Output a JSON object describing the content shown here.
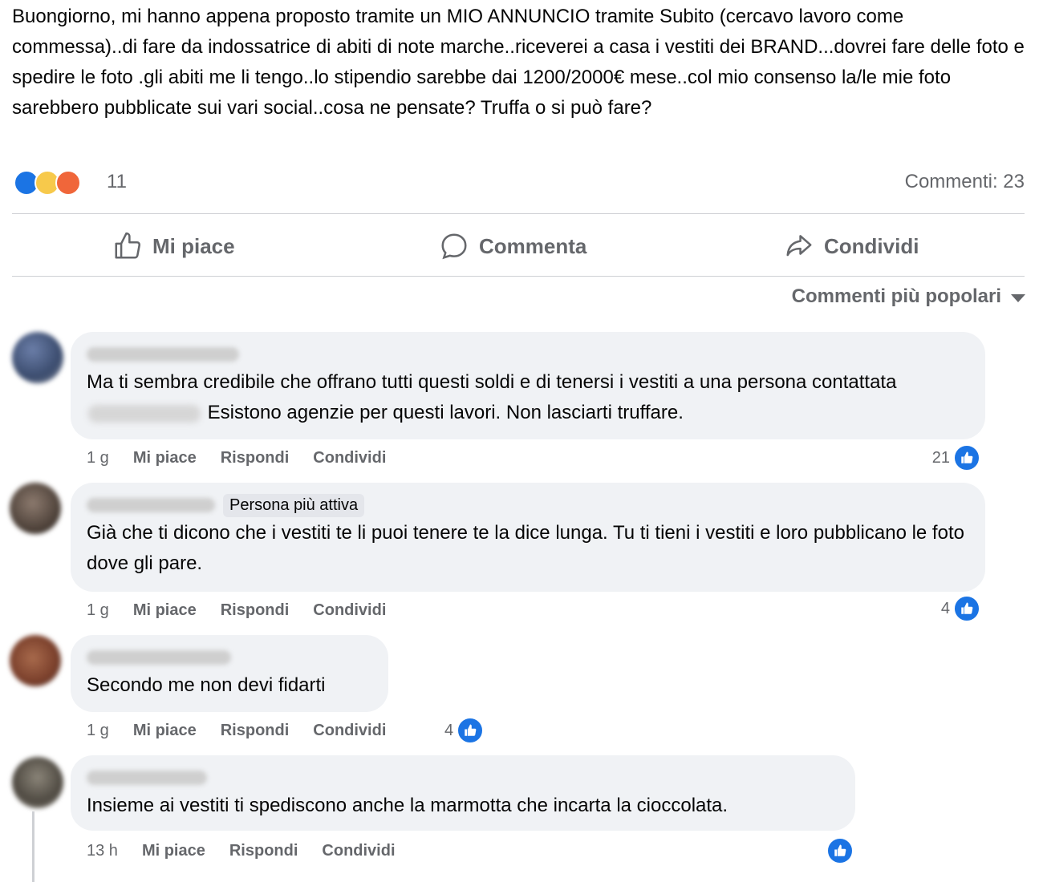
{
  "post": {
    "text": "Buongiorno, mi hanno appena proposto tramite un MIO ANNUNCIO tramite Subito (cercavo lavoro come commessa)..di fare da indossatrice di abiti di note marche..riceverei a casa i vestiti dei BRAND...dovrei fare delle foto e spedire le foto .gli abiti me li tengo..lo stipendio sarebbe dai 1200/2000€ mese..col mio consenso la/le mie foto sarebbero pubblicate sui vari social..cosa ne pensate? Truffa o si può fare?",
    "reaction_icons": [
      "like-icon",
      "haha-icon",
      "angry-icon"
    ],
    "reaction_count": "11",
    "comments_count": "Commenti: 23"
  },
  "actions": {
    "like": "Mi piace",
    "comment": "Commenta",
    "share": "Condividi"
  },
  "sort_label": "Commenti più popolari",
  "colors": {
    "accent": "#1b74e4",
    "secondary_text": "#65676b",
    "bubble_bg": "#f0f2f5"
  },
  "comments": [
    {
      "text_before": "Ma ti sembra credibile che offrano tutti questi soldi e di tenersi i vestiti a una persona contattata",
      "text_after": "Esistono agenzie per questi lavori. Non lasciarti truffare.",
      "time": "1 g",
      "like": "Mi piace",
      "reply": "Rispondi",
      "share": "Condividi",
      "likes": "21"
    },
    {
      "badge": "Persona più attiva",
      "text": "Già che ti dicono che i vestiti te li puoi tenere te la dice lunga. Tu ti tieni i vestiti e loro pubblicano le foto dove gli pare.",
      "time": "1 g",
      "like": "Mi piace",
      "reply": "Rispondi",
      "share": "Condividi",
      "likes": "4"
    },
    {
      "text": "Secondo me non devi fidarti",
      "time": "1 g",
      "like": "Mi piace",
      "reply": "Rispondi",
      "share": "Condividi",
      "likes": "4"
    },
    {
      "text": "Insieme ai vestiti ti spediscono anche la marmotta che incarta la cioccolata.",
      "time": "13 h",
      "like": "Mi piace",
      "reply": "Rispondi",
      "share": "Condividi",
      "likes": ""
    }
  ]
}
